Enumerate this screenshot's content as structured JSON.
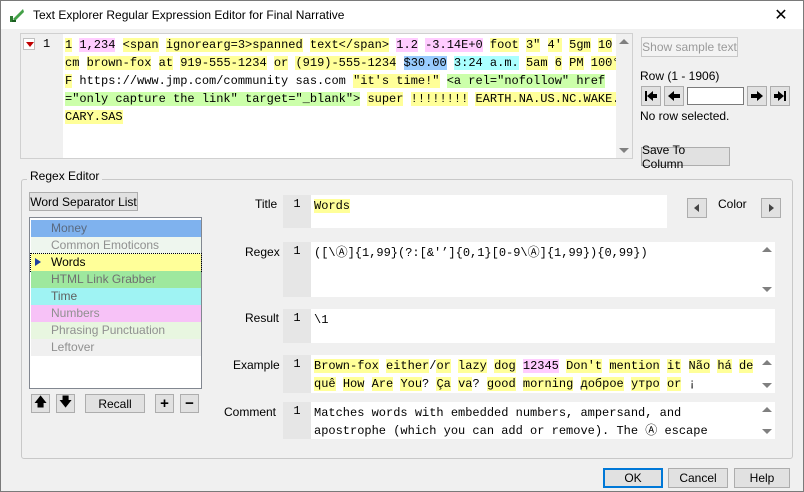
{
  "window": {
    "title": "Text Explorer Regular Expression Editor for Final Narrative",
    "close_glyph": "✕"
  },
  "sample": {
    "line_number": "1",
    "segments": [
      {
        "t": "1",
        "h": "hy"
      },
      {
        "t": " ",
        "h": ""
      },
      {
        "t": "1,234",
        "h": "hp"
      },
      {
        "t": " ",
        "h": ""
      },
      {
        "t": "<span",
        "h": "hy"
      },
      {
        "t": " ",
        "h": ""
      },
      {
        "t": "ignorearg=3>spanned",
        "h": "hy"
      },
      {
        "t": " ",
        "h": ""
      },
      {
        "t": "text</span>",
        "h": "hy"
      },
      {
        "t": " ",
        "h": ""
      },
      {
        "t": "1.2",
        "h": "hp"
      },
      {
        "t": " ",
        "h": ""
      },
      {
        "t": "-3.14E+0",
        "h": "hp"
      },
      {
        "t": " ",
        "h": ""
      },
      {
        "t": "foot",
        "h": "hy"
      },
      {
        "t": " ",
        "h": ""
      },
      {
        "t": "3\"",
        "h": "hy"
      },
      {
        "t": " ",
        "h": ""
      },
      {
        "t": "4'",
        "h": "hy"
      },
      {
        "t": " ",
        "h": ""
      },
      {
        "t": "5gm",
        "h": "hy"
      },
      {
        "t": "  ",
        "h": ""
      },
      {
        "t": "10",
        "h": "hy"
      },
      {
        "t": " ",
        "h": ""
      },
      {
        "t": "cm",
        "h": "hy"
      },
      {
        "t": " ",
        "h": ""
      },
      {
        "t": "brown-fox",
        "h": "hy"
      },
      {
        "t": " ",
        "h": ""
      },
      {
        "t": "at",
        "h": "hy"
      },
      {
        "t": " ",
        "h": ""
      },
      {
        "t": "919-555-1234",
        "h": "hy"
      },
      {
        "t": " ",
        "h": ""
      },
      {
        "t": "or",
        "h": "hy"
      },
      {
        "t": " ",
        "h": ""
      },
      {
        "t": "(919)-555-1234",
        "h": "hy"
      },
      {
        "t": " ",
        "h": ""
      },
      {
        "t": "$30.00",
        "h": "hb"
      },
      {
        "t": " ",
        "h": ""
      },
      {
        "t": "3:24 a.m.",
        "h": "hc"
      },
      {
        "t": " ",
        "h": ""
      },
      {
        "t": "5am",
        "h": "hy"
      },
      {
        "t": " ",
        "h": ""
      },
      {
        "t": "6",
        "h": "hy"
      },
      {
        "t": " ",
        "h": ""
      },
      {
        "t": "PM",
        "h": "hy"
      },
      {
        "t": " ",
        "h": ""
      },
      {
        "t": "100°F",
        "h": "hy"
      },
      {
        "t": "  ",
        "h": ""
      },
      {
        "t": "https://www.jmp.com/community",
        "h": ""
      },
      {
        "t": " ",
        "h": ""
      },
      {
        "t": "sas.com",
        "h": ""
      },
      {
        "t": "  ",
        "h": ""
      },
      {
        "t": "\"it's time!\"",
        "h": "hy"
      },
      {
        "t": " ",
        "h": ""
      },
      {
        "t": "<a rel=\"nofollow\" href=\"only capture the link\" target=\"_blank\">",
        "h": "hg"
      },
      {
        "t": " ",
        "h": ""
      },
      {
        "t": "super",
        "h": "hy"
      },
      {
        "t": " ",
        "h": ""
      },
      {
        "t": "!!!!!!!!",
        "h": "hy"
      },
      {
        "t": "  ",
        "h": ""
      },
      {
        "t": "EARTH.NA.US.NC.WAKE.CARY.SAS",
        "h": "hy"
      }
    ]
  },
  "side_panel": {
    "show_sample_label": "Show sample text",
    "row_label": "Row (1 - 1906)",
    "row_value": "",
    "row_status": "No row selected.",
    "save_to_column_label": "Save To Column"
  },
  "regex_editor": {
    "group_title": "Regex Editor",
    "word_separator_label": "Word Separator List",
    "items": [
      {
        "label": "Money",
        "bg": "#7fb2ee",
        "fg": "#5a6a80"
      },
      {
        "label": "Common Emoticons",
        "bg": "#eef6ee",
        "fg": "#909090"
      },
      {
        "label": "Words",
        "bg": "#ffff99",
        "fg": "#000000",
        "selected": true
      },
      {
        "label": "HTML Link Grabber",
        "bg": "#9ee89e",
        "fg": "#707070"
      },
      {
        "label": "Time",
        "bg": "#9ff3f3",
        "fg": "#606060"
      },
      {
        "label": "Numbers",
        "bg": "#f7c2f7",
        "fg": "#909090"
      },
      {
        "label": "Phrasing Punctuation",
        "bg": "#e8f6e0",
        "fg": "#909090"
      },
      {
        "label": "Leftover",
        "bg": "#f0f0f0",
        "fg": "#909090"
      }
    ],
    "up_glyph": "🡅",
    "down_glyph": "🡇",
    "recall_label": "Recall",
    "add_glyph": "+",
    "remove_glyph": "−",
    "title_label": "Title",
    "title_num": "1",
    "title_value": "Words",
    "color_label": "Color",
    "regex_label": "Regex",
    "regex_num": "1",
    "regex_value": "([\\Ⓐ]{1,99}(?:[&'’]{0,1}[0-9\\Ⓐ]{1,99}){0,99})",
    "result_label": "Result",
    "result_num": "1",
    "result_value": "\\1",
    "example_label": "Example",
    "example_num": "1",
    "example_segments": [
      {
        "t": "Brown-fox",
        "h": "hy"
      },
      {
        "t": " ",
        "h": ""
      },
      {
        "t": "either",
        "h": "hy"
      },
      {
        "t": "/",
        "h": ""
      },
      {
        "t": "or",
        "h": "hy"
      },
      {
        "t": " ",
        "h": ""
      },
      {
        "t": "lazy",
        "h": "hy"
      },
      {
        "t": " ",
        "h": ""
      },
      {
        "t": "dog",
        "h": "hy"
      },
      {
        "t": " ",
        "h": ""
      },
      {
        "t": "12345",
        "h": "hp"
      },
      {
        "t": " ",
        "h": ""
      },
      {
        "t": "Don't",
        "h": "hy"
      },
      {
        "t": " ",
        "h": ""
      },
      {
        "t": "mention",
        "h": "hy"
      },
      {
        "t": " ",
        "h": ""
      },
      {
        "t": "it",
        "h": "hy"
      },
      {
        "t": " ",
        "h": ""
      },
      {
        "t": "Não",
        "h": "hy"
      },
      {
        "t": " ",
        "h": ""
      },
      {
        "t": "há",
        "h": "hy"
      },
      {
        "t": " ",
        "h": ""
      },
      {
        "t": "de",
        "h": "hy"
      },
      {
        "t": " ",
        "h": ""
      },
      {
        "t": "quê",
        "h": "hy"
      },
      {
        "t": " ",
        "h": ""
      },
      {
        "t": "How",
        "h": "hy"
      },
      {
        "t": " ",
        "h": ""
      },
      {
        "t": "Are",
        "h": "hy"
      },
      {
        "t": " ",
        "h": ""
      },
      {
        "t": "You",
        "h": "hy"
      },
      {
        "t": "? ",
        "h": ""
      },
      {
        "t": "Ça",
        "h": "hy"
      },
      {
        "t": " ",
        "h": ""
      },
      {
        "t": "va",
        "h": "hy"
      },
      {
        "t": "?  ",
        "h": ""
      },
      {
        "t": "good",
        "h": "hy"
      },
      {
        "t": " ",
        "h": ""
      },
      {
        "t": "morning",
        "h": "hy"
      },
      {
        "t": " ",
        "h": ""
      },
      {
        "t": "доброе",
        "h": "hy"
      },
      {
        "t": " ",
        "h": ""
      },
      {
        "t": "утро",
        "h": "hy"
      },
      {
        "t": " ",
        "h": ""
      },
      {
        "t": "or",
        "h": "hy"
      },
      {
        "t": " ¡",
        "h": ""
      }
    ],
    "comment_label": "Comment",
    "comment_num": "1",
    "comment_value": "Matches words with embedded numbers, ampersand, and apostrophe (which you can add or remove).  The Ⓐ escape"
  },
  "footer": {
    "ok_label": "OK",
    "cancel_label": "Cancel",
    "help_label": "Help"
  },
  "colors": {
    "accent": "#0078d7",
    "yellow": "#ffff99",
    "pink": "#ffccff",
    "green": "#ccffaa",
    "blue": "#99ccff",
    "cyan": "#aaffff"
  }
}
